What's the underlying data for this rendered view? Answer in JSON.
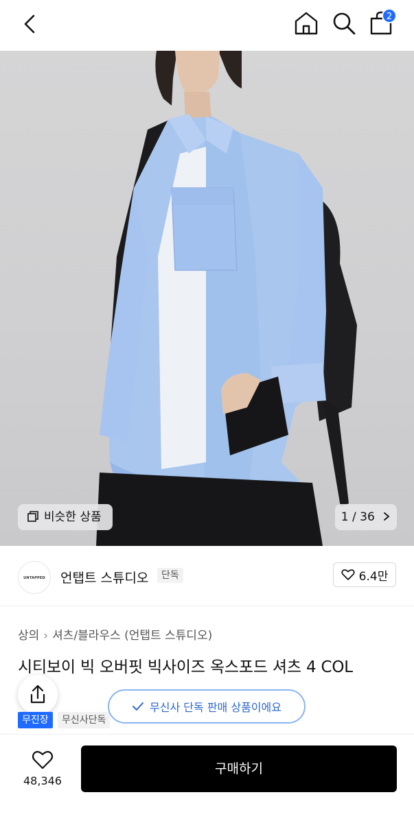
{
  "header": {
    "cart_count": "2"
  },
  "gallery": {
    "similar_label": "비슷한 상품",
    "counter": "1 / 36"
  },
  "brand": {
    "logo_text": "UNTAPPED",
    "name": "언탭트 스튜디오",
    "tag": "단독",
    "likes": "6.4만"
  },
  "breadcrumb": {
    "level1": "상의",
    "level2": "셔츠/블라우스 (언탭트 스튜디오)"
  },
  "product": {
    "title": "시티보이 빅 오버핏 빅사이즈 옥스포드 셔츠 4 COL",
    "badge_primary": "무진장",
    "badge_secondary": "무신사단독"
  },
  "toast": {
    "message": "무신사 단독 판매 상품이에요"
  },
  "bottom_bar": {
    "wish_count": "48,346",
    "buy_label": "구매하기"
  },
  "colors": {
    "accent": "#1f6bff",
    "toast_text": "#2b67d1",
    "buy_button": "#000000"
  }
}
